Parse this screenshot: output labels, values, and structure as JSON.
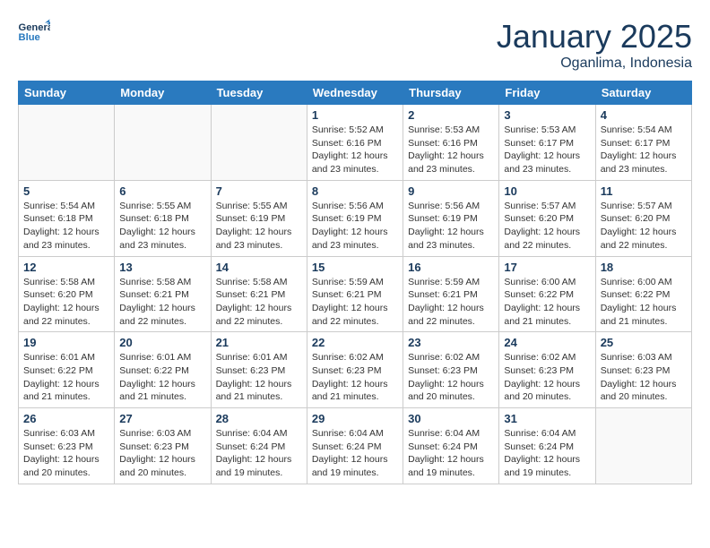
{
  "header": {
    "logo_general": "General",
    "logo_blue": "Blue",
    "month": "January 2025",
    "location": "Oganlima, Indonesia"
  },
  "weekdays": [
    "Sunday",
    "Monday",
    "Tuesday",
    "Wednesday",
    "Thursday",
    "Friday",
    "Saturday"
  ],
  "weeks": [
    [
      {
        "day": "",
        "sunrise": "",
        "sunset": "",
        "daylight": ""
      },
      {
        "day": "",
        "sunrise": "",
        "sunset": "",
        "daylight": ""
      },
      {
        "day": "",
        "sunrise": "",
        "sunset": "",
        "daylight": ""
      },
      {
        "day": "1",
        "sunrise": "Sunrise: 5:52 AM",
        "sunset": "Sunset: 6:16 PM",
        "daylight": "Daylight: 12 hours and 23 minutes."
      },
      {
        "day": "2",
        "sunrise": "Sunrise: 5:53 AM",
        "sunset": "Sunset: 6:16 PM",
        "daylight": "Daylight: 12 hours and 23 minutes."
      },
      {
        "day": "3",
        "sunrise": "Sunrise: 5:53 AM",
        "sunset": "Sunset: 6:17 PM",
        "daylight": "Daylight: 12 hours and 23 minutes."
      },
      {
        "day": "4",
        "sunrise": "Sunrise: 5:54 AM",
        "sunset": "Sunset: 6:17 PM",
        "daylight": "Daylight: 12 hours and 23 minutes."
      }
    ],
    [
      {
        "day": "5",
        "sunrise": "Sunrise: 5:54 AM",
        "sunset": "Sunset: 6:18 PM",
        "daylight": "Daylight: 12 hours and 23 minutes."
      },
      {
        "day": "6",
        "sunrise": "Sunrise: 5:55 AM",
        "sunset": "Sunset: 6:18 PM",
        "daylight": "Daylight: 12 hours and 23 minutes."
      },
      {
        "day": "7",
        "sunrise": "Sunrise: 5:55 AM",
        "sunset": "Sunset: 6:19 PM",
        "daylight": "Daylight: 12 hours and 23 minutes."
      },
      {
        "day": "8",
        "sunrise": "Sunrise: 5:56 AM",
        "sunset": "Sunset: 6:19 PM",
        "daylight": "Daylight: 12 hours and 23 minutes."
      },
      {
        "day": "9",
        "sunrise": "Sunrise: 5:56 AM",
        "sunset": "Sunset: 6:19 PM",
        "daylight": "Daylight: 12 hours and 23 minutes."
      },
      {
        "day": "10",
        "sunrise": "Sunrise: 5:57 AM",
        "sunset": "Sunset: 6:20 PM",
        "daylight": "Daylight: 12 hours and 22 minutes."
      },
      {
        "day": "11",
        "sunrise": "Sunrise: 5:57 AM",
        "sunset": "Sunset: 6:20 PM",
        "daylight": "Daylight: 12 hours and 22 minutes."
      }
    ],
    [
      {
        "day": "12",
        "sunrise": "Sunrise: 5:58 AM",
        "sunset": "Sunset: 6:20 PM",
        "daylight": "Daylight: 12 hours and 22 minutes."
      },
      {
        "day": "13",
        "sunrise": "Sunrise: 5:58 AM",
        "sunset": "Sunset: 6:21 PM",
        "daylight": "Daylight: 12 hours and 22 minutes."
      },
      {
        "day": "14",
        "sunrise": "Sunrise: 5:58 AM",
        "sunset": "Sunset: 6:21 PM",
        "daylight": "Daylight: 12 hours and 22 minutes."
      },
      {
        "day": "15",
        "sunrise": "Sunrise: 5:59 AM",
        "sunset": "Sunset: 6:21 PM",
        "daylight": "Daylight: 12 hours and 22 minutes."
      },
      {
        "day": "16",
        "sunrise": "Sunrise: 5:59 AM",
        "sunset": "Sunset: 6:21 PM",
        "daylight": "Daylight: 12 hours and 22 minutes."
      },
      {
        "day": "17",
        "sunrise": "Sunrise: 6:00 AM",
        "sunset": "Sunset: 6:22 PM",
        "daylight": "Daylight: 12 hours and 21 minutes."
      },
      {
        "day": "18",
        "sunrise": "Sunrise: 6:00 AM",
        "sunset": "Sunset: 6:22 PM",
        "daylight": "Daylight: 12 hours and 21 minutes."
      }
    ],
    [
      {
        "day": "19",
        "sunrise": "Sunrise: 6:01 AM",
        "sunset": "Sunset: 6:22 PM",
        "daylight": "Daylight: 12 hours and 21 minutes."
      },
      {
        "day": "20",
        "sunrise": "Sunrise: 6:01 AM",
        "sunset": "Sunset: 6:22 PM",
        "daylight": "Daylight: 12 hours and 21 minutes."
      },
      {
        "day": "21",
        "sunrise": "Sunrise: 6:01 AM",
        "sunset": "Sunset: 6:23 PM",
        "daylight": "Daylight: 12 hours and 21 minutes."
      },
      {
        "day": "22",
        "sunrise": "Sunrise: 6:02 AM",
        "sunset": "Sunset: 6:23 PM",
        "daylight": "Daylight: 12 hours and 21 minutes."
      },
      {
        "day": "23",
        "sunrise": "Sunrise: 6:02 AM",
        "sunset": "Sunset: 6:23 PM",
        "daylight": "Daylight: 12 hours and 20 minutes."
      },
      {
        "day": "24",
        "sunrise": "Sunrise: 6:02 AM",
        "sunset": "Sunset: 6:23 PM",
        "daylight": "Daylight: 12 hours and 20 minutes."
      },
      {
        "day": "25",
        "sunrise": "Sunrise: 6:03 AM",
        "sunset": "Sunset: 6:23 PM",
        "daylight": "Daylight: 12 hours and 20 minutes."
      }
    ],
    [
      {
        "day": "26",
        "sunrise": "Sunrise: 6:03 AM",
        "sunset": "Sunset: 6:23 PM",
        "daylight": "Daylight: 12 hours and 20 minutes."
      },
      {
        "day": "27",
        "sunrise": "Sunrise: 6:03 AM",
        "sunset": "Sunset: 6:23 PM",
        "daylight": "Daylight: 12 hours and 20 minutes."
      },
      {
        "day": "28",
        "sunrise": "Sunrise: 6:04 AM",
        "sunset": "Sunset: 6:24 PM",
        "daylight": "Daylight: 12 hours and 19 minutes."
      },
      {
        "day": "29",
        "sunrise": "Sunrise: 6:04 AM",
        "sunset": "Sunset: 6:24 PM",
        "daylight": "Daylight: 12 hours and 19 minutes."
      },
      {
        "day": "30",
        "sunrise": "Sunrise: 6:04 AM",
        "sunset": "Sunset: 6:24 PM",
        "daylight": "Daylight: 12 hours and 19 minutes."
      },
      {
        "day": "31",
        "sunrise": "Sunrise: 6:04 AM",
        "sunset": "Sunset: 6:24 PM",
        "daylight": "Daylight: 12 hours and 19 minutes."
      },
      {
        "day": "",
        "sunrise": "",
        "sunset": "",
        "daylight": ""
      }
    ]
  ]
}
